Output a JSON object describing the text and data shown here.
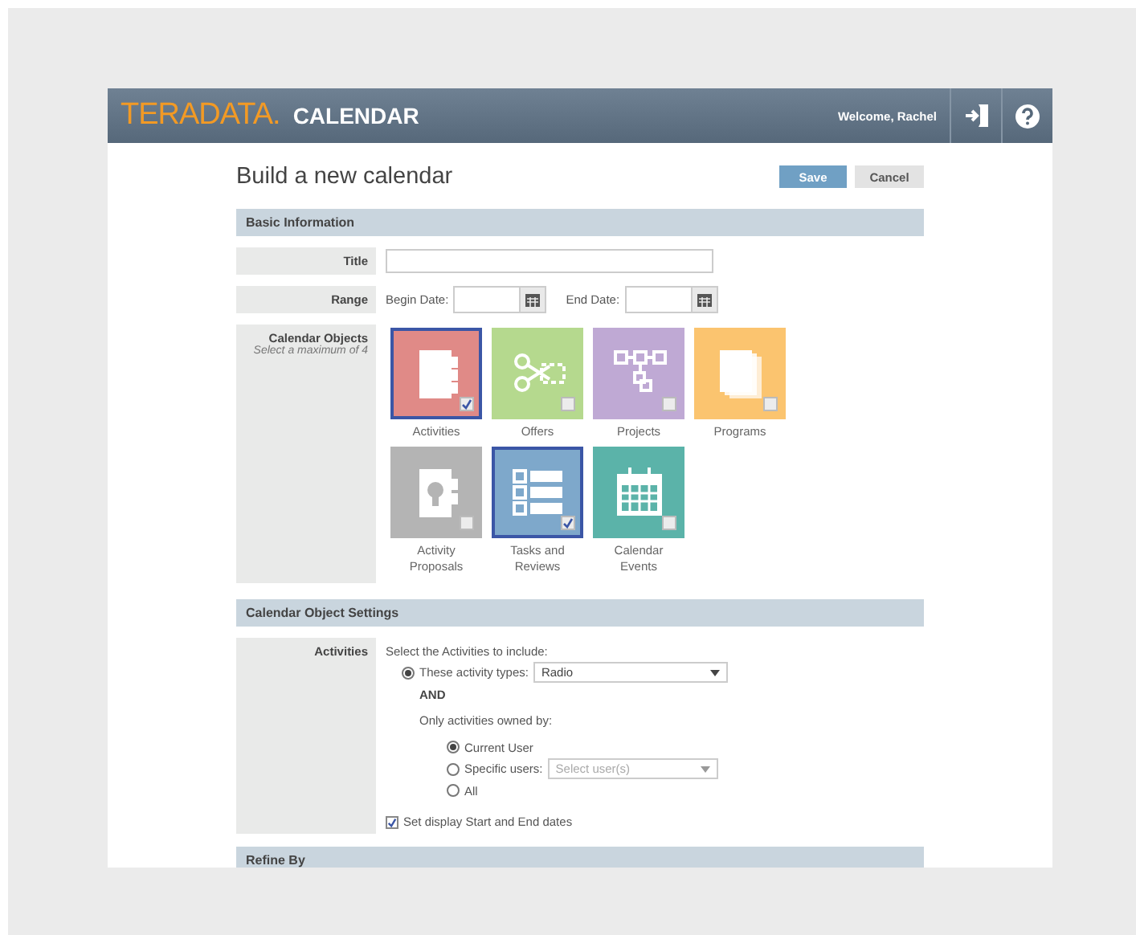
{
  "header": {
    "logo": "TERADATA.",
    "title": "CALENDAR",
    "welcome": "Welcome, Rachel"
  },
  "page_title": "Build a new calendar",
  "buttons": [
    {
      "kind": "primary",
      "label": "Save"
    },
    {
      "kind": "secondary",
      "label": "Cancel"
    }
  ],
  "basic_information": {
    "heading": "Basic Information",
    "title_label": "Title",
    "range_label": "Range",
    "begin_label": "Begin Date:",
    "end_label": "End Date:",
    "objects_label": "Calendar Objects",
    "objects_hint": "Select a maximum of 4",
    "objects": [
      {
        "kind": "notebook",
        "label": "Activities",
        "color": "#e08a87",
        "checked": true
      },
      {
        "kind": "scissors",
        "label": "Offers",
        "color": "#b5d98e",
        "checked": false
      },
      {
        "kind": "flow",
        "label": "Projects",
        "color": "#bfa9d4",
        "checked": false
      },
      {
        "kind": "stack",
        "label": "Programs",
        "color": "#fbc46f",
        "checked": false
      },
      {
        "kind": "bulb",
        "label": "Activity Proposals",
        "color": "#b4b4b4",
        "checked": false
      },
      {
        "kind": "checklist",
        "label": "Tasks and Reviews",
        "color": "#7ea8cb",
        "checked": true
      },
      {
        "kind": "calendar",
        "label": "Calendar Events",
        "color": "#5bb3a9",
        "checked": false
      }
    ]
  },
  "object_settings": {
    "heading": "Calendar Object Settings",
    "label": "Activities",
    "intro": "Select the Activities to include:",
    "types_option": {
      "label": "These activity types:",
      "selected": true,
      "value": "Radio"
    },
    "and": "AND",
    "owned_by": "Only activities owned by:",
    "owners": [
      {
        "label": "Current User",
        "selected": true
      },
      {
        "label": "Specific users:",
        "selected": false,
        "placeholder": "Select user(s)"
      },
      {
        "label": "All",
        "selected": false
      }
    ],
    "display_dates": {
      "label": "Set display Start and End dates",
      "checked": true
    }
  },
  "refine": {
    "heading": "Refine By"
  }
}
